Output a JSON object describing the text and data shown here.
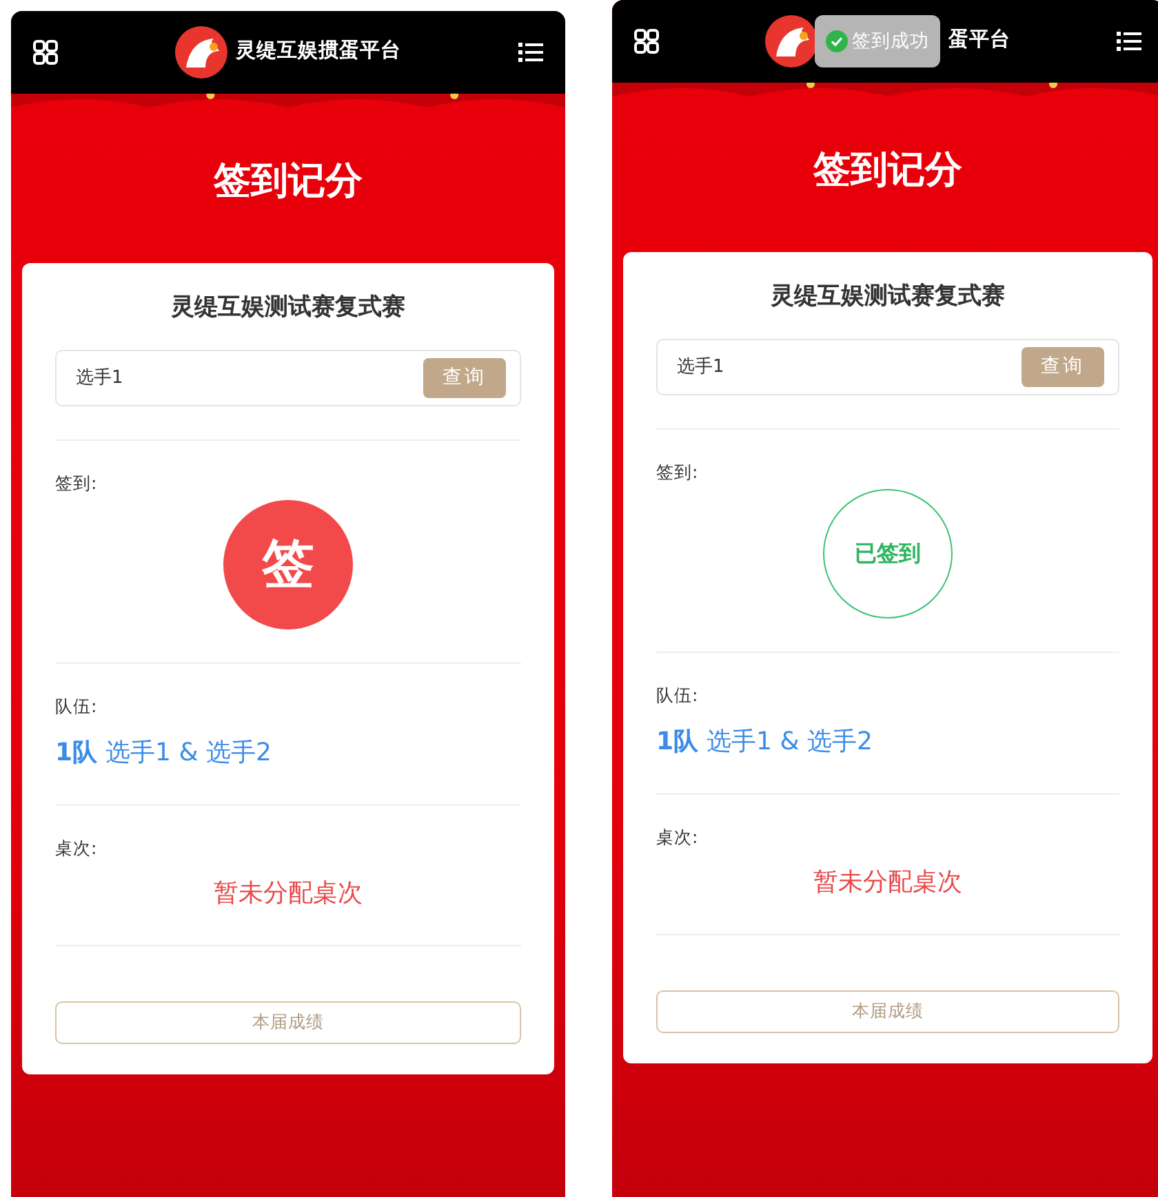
{
  "screens": [
    {
      "header": {
        "title": "灵缇互娱掼蛋平台"
      },
      "page_title": "签到记分",
      "card": {
        "match_title": "灵缇互娱测试赛复式赛",
        "search": {
          "value": "选手1",
          "button": "查询"
        },
        "checkin": {
          "label": "签到:",
          "text": "签",
          "checked": false
        },
        "team": {
          "label": "队伍:",
          "number": "1队",
          "players": "选手1 & 选手2"
        },
        "table": {
          "label": "桌次:",
          "value": "暂未分配桌次"
        },
        "results_button": "本届成绩"
      }
    },
    {
      "header": {
        "title": "蛋平台",
        "toast": "签到成功"
      },
      "page_title": "签到记分",
      "card": {
        "match_title": "灵缇互娱测试赛复式赛",
        "search": {
          "value": "选手1",
          "button": "查询"
        },
        "checkin": {
          "label": "签到:",
          "text": "已签到",
          "checked": true
        },
        "team": {
          "label": "队伍:",
          "number": "1队",
          "players": "选手1 & 选手2"
        },
        "table": {
          "label": "桌次:",
          "value": "暂未分配桌次"
        },
        "results_button": "本届成绩"
      }
    }
  ]
}
